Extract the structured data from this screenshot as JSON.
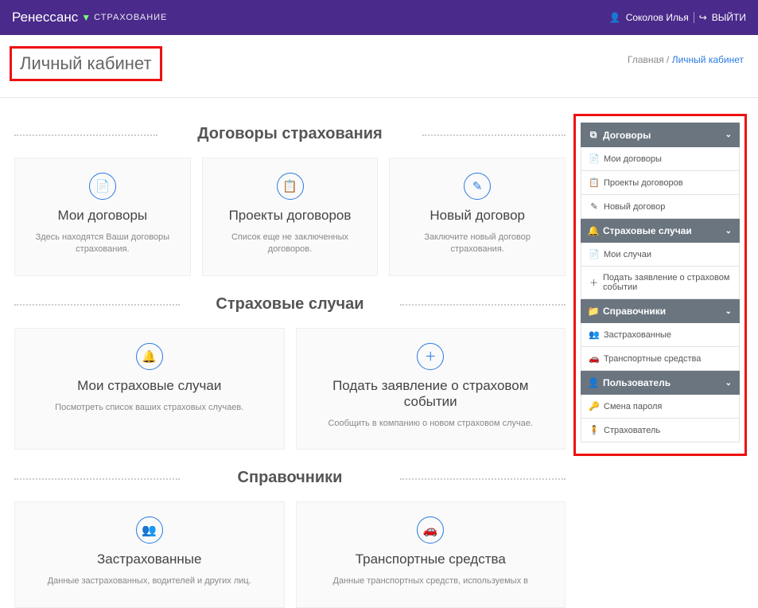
{
  "header": {
    "brand_main": "Ренессанс",
    "brand_sub": "СТРАХОВАНИЕ",
    "user_name": "Соколов Илья",
    "logout": "ВЫЙТИ"
  },
  "page": {
    "title": "Личный кабинет",
    "breadcrumb_home": "Главная",
    "breadcrumb_current": "Личный кабинет"
  },
  "sections": {
    "contracts": {
      "title": "Договоры страхования",
      "cards": [
        {
          "title": "Мои договоры",
          "desc": "Здесь находятся Ваши договоры страхования."
        },
        {
          "title": "Проекты договоров",
          "desc": "Список еще не заключенных договоров."
        },
        {
          "title": "Новый договор",
          "desc": "Заключите новый договор страхования."
        }
      ]
    },
    "cases": {
      "title": "Страховые случаи",
      "cards": [
        {
          "title": "Мои страховые случаи",
          "desc": "Посмотреть список ваших страховых случаев."
        },
        {
          "title": "Подать заявление о страховом событии",
          "desc": "Сообщить в компанию о новом страховом случае."
        }
      ]
    },
    "refs": {
      "title": "Справочники",
      "cards": [
        {
          "title": "Застрахованные",
          "desc": "Данные застрахованных, водителей и других лиц."
        },
        {
          "title": "Транспортные средства",
          "desc": "Данные транспортных средств, используемых в"
        }
      ]
    }
  },
  "sidebar": {
    "groups": [
      {
        "label": "Договоры",
        "items": [
          {
            "label": "Мои договоры"
          },
          {
            "label": "Проекты договоров"
          },
          {
            "label": "Новый договор"
          }
        ]
      },
      {
        "label": "Страховые случаи",
        "items": [
          {
            "label": "Мои случаи"
          },
          {
            "label": "Подать заявление о страховом событии"
          }
        ]
      },
      {
        "label": "Справочники",
        "items": [
          {
            "label": "Застрахованные"
          },
          {
            "label": "Транспортные средства"
          }
        ]
      },
      {
        "label": "Пользователь",
        "items": [
          {
            "label": "Смена пароля"
          },
          {
            "label": "Страхователь"
          }
        ]
      }
    ]
  }
}
